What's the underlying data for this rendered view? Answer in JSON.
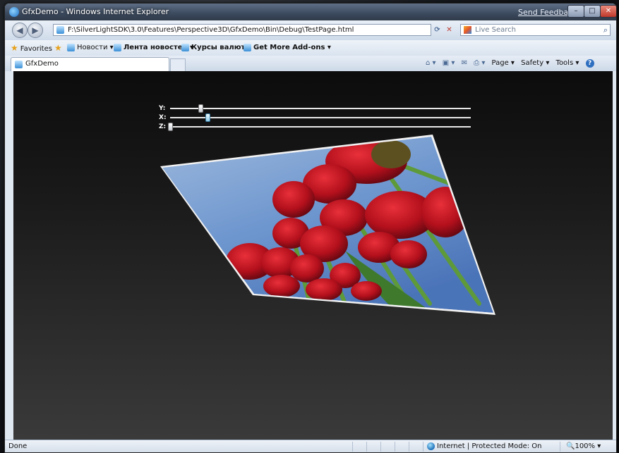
{
  "window": {
    "title": "GfxDemo - Windows Internet Explorer",
    "send_feedback": "Send Feedback"
  },
  "nav": {
    "address": "F:\\SilverLightSDK\\3.0\\Features\\Perspective3D\\GfxDemo\\Bin\\Debug\\TestPage.html",
    "search_placeholder": "Live Search"
  },
  "favorites": {
    "label": "Favorites",
    "items": [
      {
        "label": "Новости ▾"
      },
      {
        "label": "Лента новостей ▾"
      },
      {
        "label": "Курсы валют ▾"
      },
      {
        "label": "Get More Add-ons ▾"
      }
    ]
  },
  "tabs": [
    {
      "label": "GfxDemo"
    }
  ],
  "command_bar": {
    "page": "Page ▾",
    "safety": "Safety ▾",
    "tools": "Tools ▾"
  },
  "sliders": [
    {
      "label": "Y:",
      "value": 0.1
    },
    {
      "label": "X:",
      "value": 0.125
    },
    {
      "label": "Z:",
      "value": 0.0
    }
  ],
  "status": {
    "text": "Done",
    "zone": "Internet | Protected Mode: On",
    "zoom": "100%"
  }
}
